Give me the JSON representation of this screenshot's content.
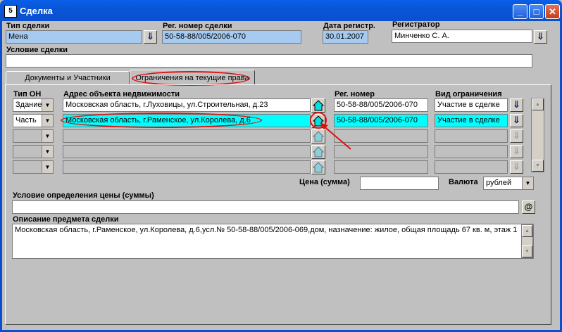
{
  "window": {
    "title": "Сделка",
    "icon_text": "5"
  },
  "header": {
    "deal_type_label": "Тип сделки",
    "deal_type_value": "Мена",
    "reg_number_label": "Рег. номер сделки",
    "reg_number_value": "50-58-88/005/2006-070",
    "reg_date_label": "Дата регистр.",
    "reg_date_value": "30.01.2007",
    "registrar_label": "Регистратор",
    "registrar_value": "Минченко С. А.",
    "condition_label": "Условие сделки",
    "condition_value": ""
  },
  "tabs": [
    {
      "label": "Документы и Участники"
    },
    {
      "label": "Ограничения на текущие права"
    }
  ],
  "grid": {
    "col_type": "Тип ОН",
    "col_address": "Адрес объекта недвижимости",
    "col_reg": "Рег. номер",
    "col_kind": "Вид ограничения",
    "rows": [
      {
        "type": "Здание",
        "address": "Московская область, г.Луховицы, ул.Строительная, д.23",
        "reg": "50-58-88/005/2006-070",
        "kind": "Участие в сделке"
      },
      {
        "type": "Часть",
        "address": "Московская область, г.Раменское, ул.Королева, д.6",
        "reg": "50-58-88/005/2006-070",
        "kind": "Участие в сделке"
      },
      {
        "type": "",
        "address": "",
        "reg": "",
        "kind": ""
      },
      {
        "type": "",
        "address": "",
        "reg": "",
        "kind": ""
      }
    ]
  },
  "price": {
    "label": "Цена (сумма)",
    "value": "",
    "currency_label": "Валюта",
    "currency_value": "рублей"
  },
  "price_condition": {
    "label": "Условие определения цены (суммы)",
    "value": "",
    "button": "@"
  },
  "description": {
    "label": "Описание предмета сделки",
    "value": "Московская область, г.Раменское, ул.Королева, д.6,усл.№ 50-58-88/005/2006-069,дом, назначение: жилое, общая площадь 67 кв. м, этаж 1"
  },
  "colors": {
    "selected_row": "#00ffff",
    "readonly_field": "#a6caf0",
    "annotation": "#e01010"
  },
  "icons": [
    "app-icon",
    "minimize-icon",
    "maximize-icon",
    "close-icon",
    "download-arrow-icon",
    "home-icon",
    "chevron-down-icon",
    "scroll-up-icon",
    "scroll-down-icon"
  ]
}
